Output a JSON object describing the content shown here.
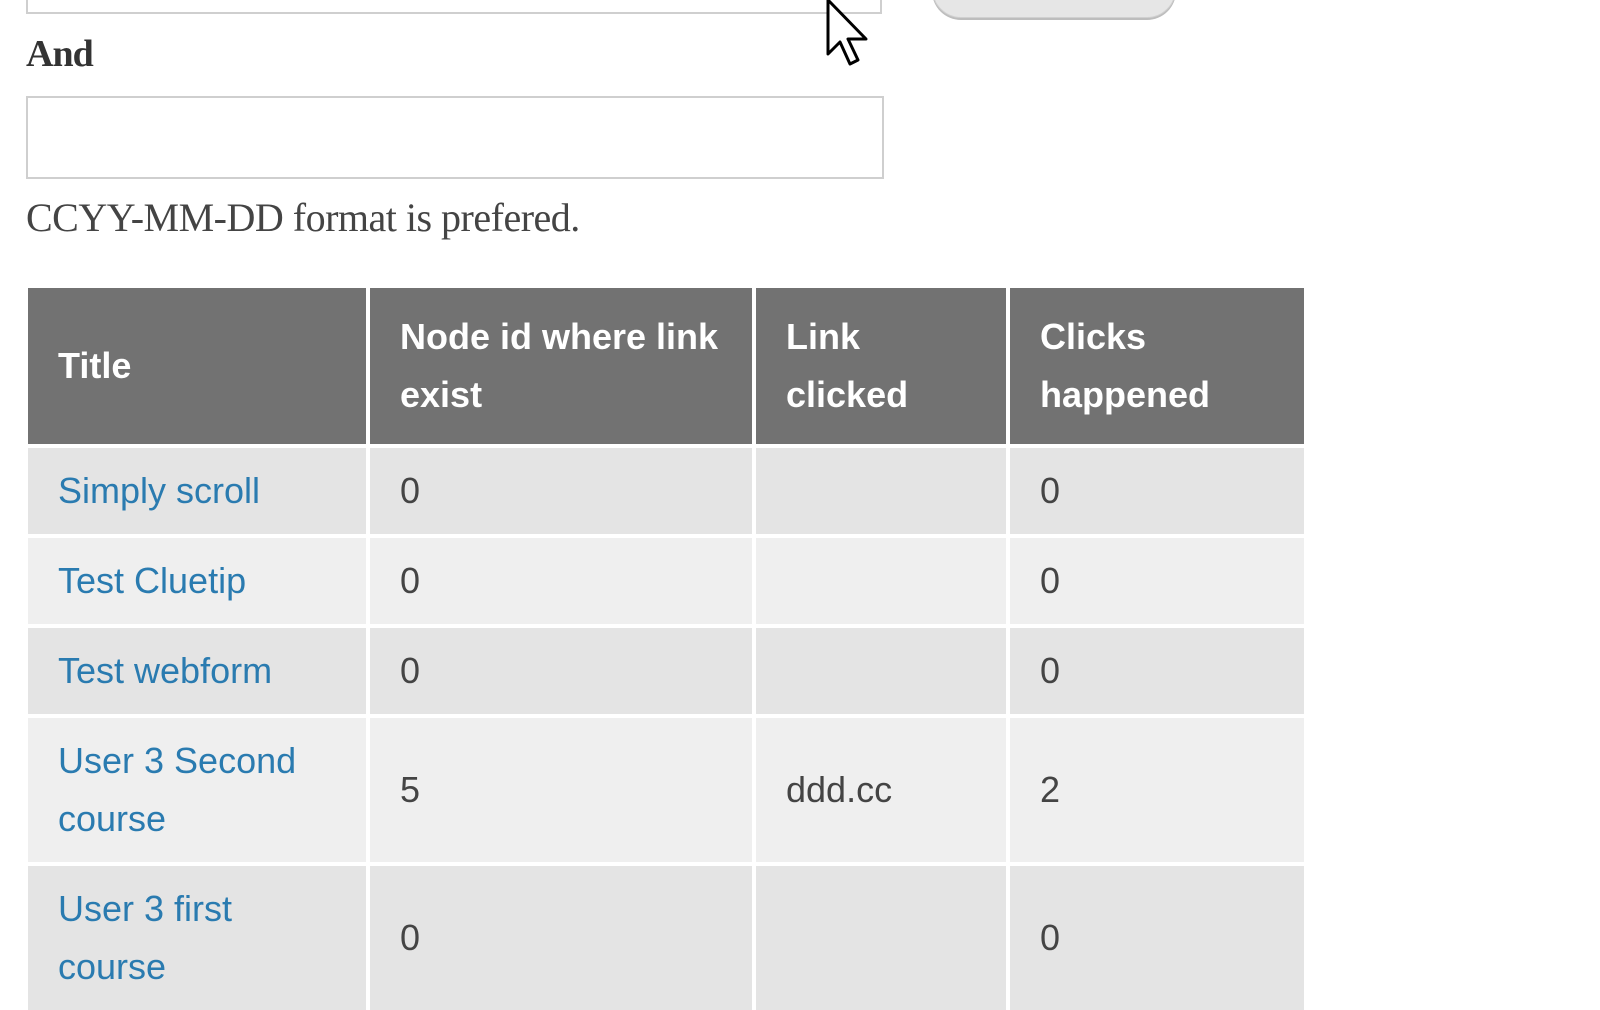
{
  "form": {
    "between_input_value": "",
    "submit_button_label": "",
    "and_label": "And",
    "and_input_value": "",
    "date_format_help": "CCYY-MM-DD format is prefered."
  },
  "table": {
    "headers": [
      "Title",
      "Node id where link exist",
      "Link clicked",
      "Clicks happened"
    ],
    "rows": [
      {
        "title": "Simply scroll",
        "node_id": "0",
        "link_clicked": "",
        "clicks": "0"
      },
      {
        "title": "Test Cluetip",
        "node_id": "0",
        "link_clicked": "",
        "clicks": "0"
      },
      {
        "title": "Test webform",
        "node_id": "0",
        "link_clicked": "",
        "clicks": "0"
      },
      {
        "title": "User 3 Second course",
        "node_id": "5",
        "link_clicked": "ddd.cc",
        "clicks": "2"
      },
      {
        "title": "User 3 first course",
        "node_id": "0",
        "link_clicked": "",
        "clicks": "0"
      }
    ]
  },
  "colors": {
    "header_bg": "#727272",
    "row_odd_bg": "#e4e4e4",
    "row_even_bg": "#efefef",
    "link_color": "#2a7bb0"
  }
}
